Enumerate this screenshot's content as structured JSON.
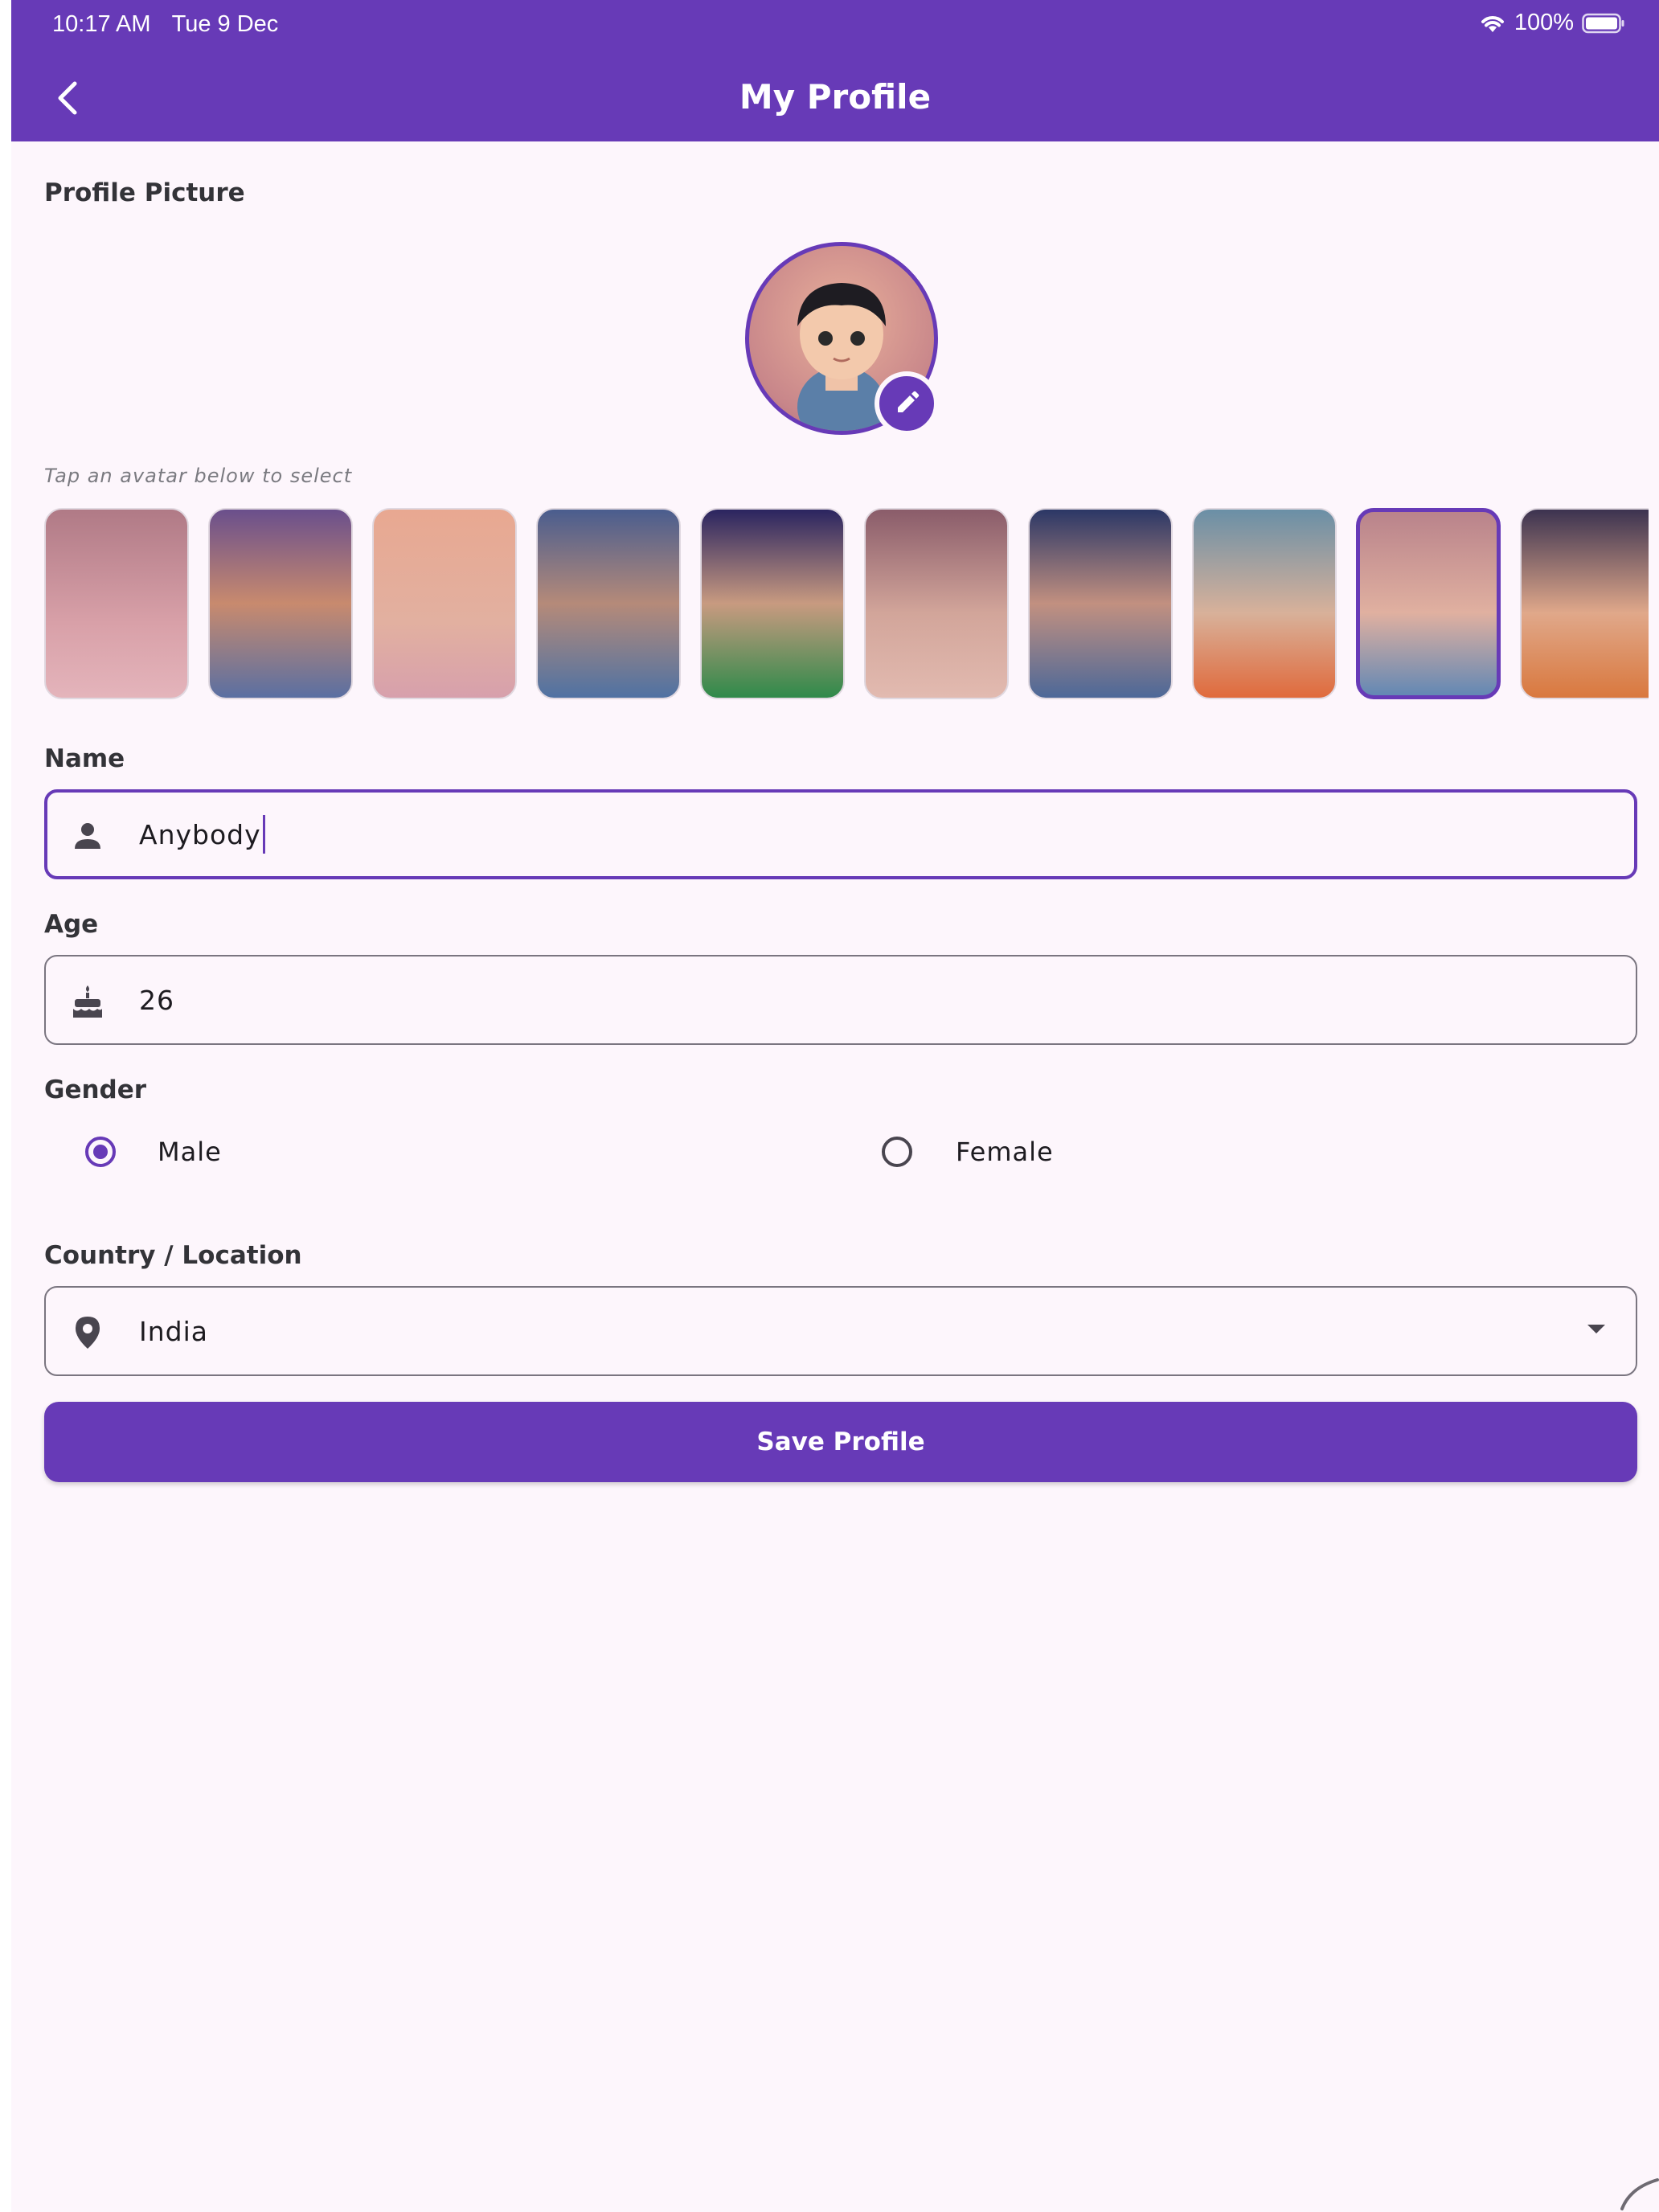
{
  "status_bar": {
    "time": "10:17 AM",
    "date": "Tue 9 Dec",
    "battery": "100%"
  },
  "appbar": {
    "title": "My Profile",
    "back_icon": "chevron-left-icon"
  },
  "profile_picture": {
    "section_label": "Profile Picture",
    "edit_icon": "pencil-icon",
    "hint": "Tap an avatar below to select",
    "selected_index": 8,
    "avatar_count_visible": 10
  },
  "name": {
    "label": "Name",
    "value": "Anybody",
    "icon": "person-icon"
  },
  "age": {
    "label": "Age",
    "value": "26",
    "icon": "cake-icon"
  },
  "gender": {
    "label": "Gender",
    "options": [
      {
        "label": "Male",
        "selected": true
      },
      {
        "label": "Female",
        "selected": false
      }
    ]
  },
  "location": {
    "label": "Country / Location",
    "value": "India",
    "icon": "location-pin-icon"
  },
  "save_button": {
    "label": "Save Profile"
  },
  "colors": {
    "primary": "#673ab7",
    "background": "#fdf6fc",
    "text": "#1d1b20"
  }
}
